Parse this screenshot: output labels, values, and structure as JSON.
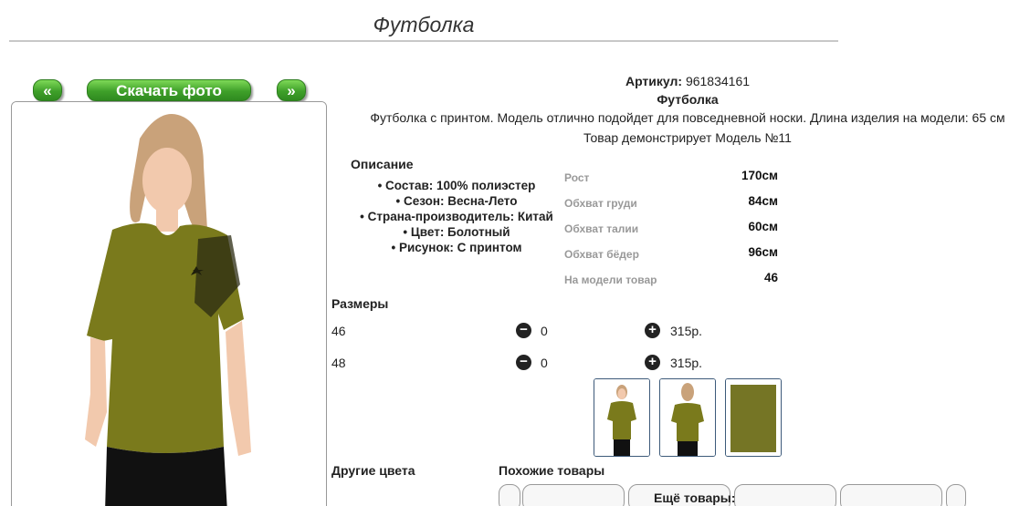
{
  "page": {
    "title": "Футболка"
  },
  "nav": {
    "prev_label": "«",
    "download_label": "Скачать фото",
    "next_label": "»"
  },
  "product": {
    "article_label": "Артикул:",
    "article_value": "961834161",
    "name": "Футболка",
    "description": "Футболка с принтом. Модель отлично подойдет для повседневной носки. Длина изделия на модели: 65 см",
    "model_line": "Товар демонстрирует Модель №11"
  },
  "description_section": {
    "title": "Описание",
    "items": [
      "Состав: 100% полиэстер",
      "Сезон: Весна-Лето",
      "Страна-производитель: Китай",
      "Цвет: Болотный",
      "Рисунок: С принтом"
    ]
  },
  "measurements": [
    {
      "label": "Рост",
      "value": "170см"
    },
    {
      "label": "Обхват груди",
      "value": "84см"
    },
    {
      "label": "Обхват талии",
      "value": "60см"
    },
    {
      "label": "Обхват бёдер",
      "value": "96см"
    },
    {
      "label": "На модели товар",
      "value": "46"
    }
  ],
  "sizes_section": {
    "title": "Размеры",
    "rows": [
      {
        "size": "46",
        "qty": "0",
        "price": "315р."
      },
      {
        "size": "48",
        "qty": "0",
        "price": "315р."
      }
    ]
  },
  "bottom": {
    "other_colors_title": "Другие цвета",
    "similar_title": "Похожие товары",
    "more_title": "Ещё товары:"
  },
  "colors": {
    "shirt": "#7a7a1c",
    "button_green": "#3fa02a",
    "thumb_border": "#3d5a7a"
  }
}
